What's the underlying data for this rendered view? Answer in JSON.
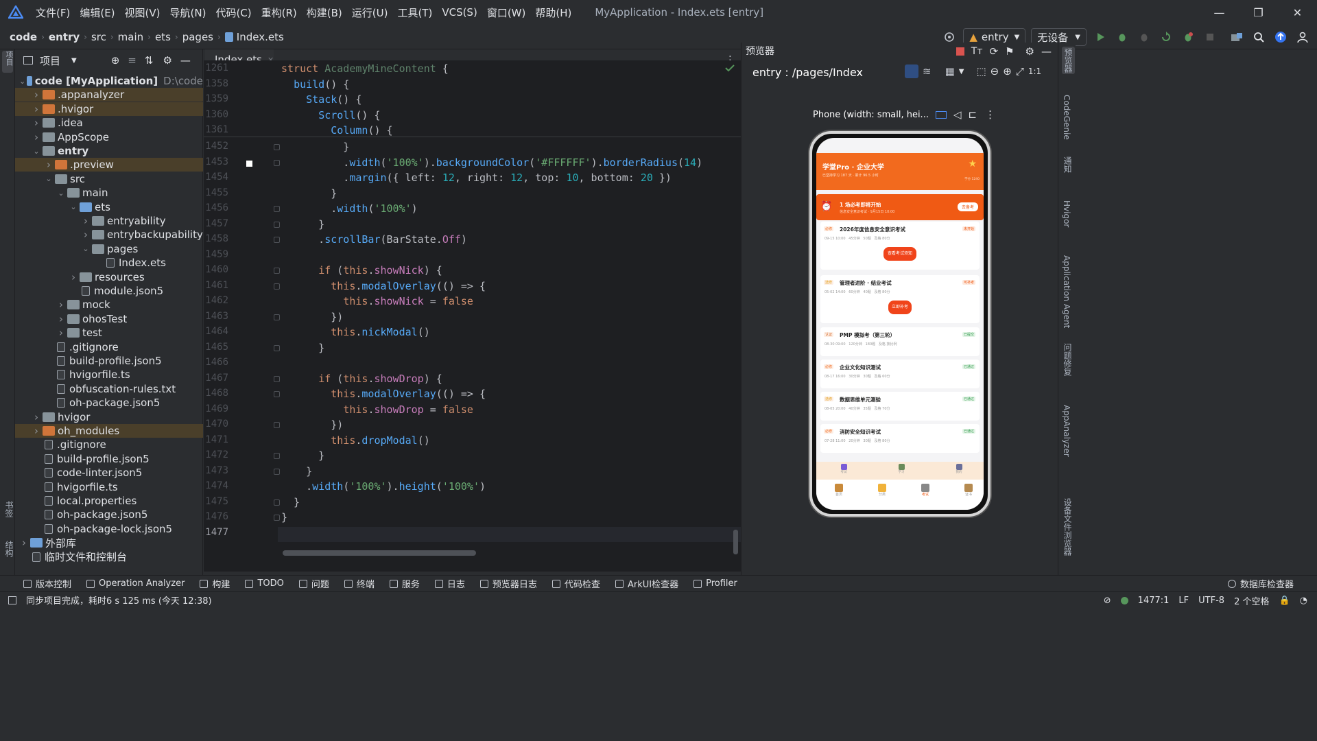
{
  "menu": [
    "文件(F)",
    "编辑(E)",
    "视图(V)",
    "导航(N)",
    "代码(C)",
    "重构(R)",
    "构建(B)",
    "运行(U)",
    "工具(T)",
    "VCS(S)",
    "窗口(W)",
    "帮助(H)"
  ],
  "window_title": "MyApplication - Index.ets [entry]",
  "breadcrumb": [
    "code",
    "entry",
    "src",
    "main",
    "ets",
    "pages",
    "Index.ets"
  ],
  "run_config": "entry",
  "device": "无设备",
  "project_panel": {
    "title": "项目",
    "tree": [
      {
        "depth": 0,
        "arrow": "open",
        "icon": "folder-blue",
        "label": "code [MyApplication]",
        "extra": "D:\\code",
        "bold": true
      },
      {
        "depth": 1,
        "arrow": "closed",
        "icon": "folder-orange",
        "label": ".appanalyzer",
        "hl": "sel"
      },
      {
        "depth": 1,
        "arrow": "closed",
        "icon": "folder-orange",
        "label": ".hvigor",
        "hl": "sel"
      },
      {
        "depth": 1,
        "arrow": "closed",
        "icon": "folder",
        "label": ".idea"
      },
      {
        "depth": 1,
        "arrow": "closed",
        "icon": "folder",
        "label": "AppScope"
      },
      {
        "depth": 1,
        "arrow": "open",
        "icon": "folder",
        "label": "entry",
        "bold": true
      },
      {
        "depth": 2,
        "arrow": "closed",
        "icon": "folder-orange",
        "label": ".preview",
        "hl": "sel"
      },
      {
        "depth": 2,
        "arrow": "open",
        "icon": "folder",
        "label": "src"
      },
      {
        "depth": 3,
        "arrow": "open",
        "icon": "folder",
        "label": "main"
      },
      {
        "depth": 4,
        "arrow": "open",
        "icon": "folder-blue",
        "label": "ets"
      },
      {
        "depth": 5,
        "arrow": "closed",
        "icon": "folder",
        "label": "entryability"
      },
      {
        "depth": 5,
        "arrow": "closed",
        "icon": "folder",
        "label": "entrybackupability"
      },
      {
        "depth": 5,
        "arrow": "open",
        "icon": "folder",
        "label": "pages"
      },
      {
        "depth": 6,
        "arrow": "none",
        "icon": "file",
        "label": "Index.ets"
      },
      {
        "depth": 4,
        "arrow": "closed",
        "icon": "folder",
        "label": "resources"
      },
      {
        "depth": 4,
        "arrow": "none",
        "icon": "file",
        "label": "module.json5"
      },
      {
        "depth": 3,
        "arrow": "closed",
        "icon": "folder",
        "label": "mock"
      },
      {
        "depth": 3,
        "arrow": "closed",
        "icon": "folder",
        "label": "ohosTest"
      },
      {
        "depth": 3,
        "arrow": "closed",
        "icon": "folder",
        "label": "test"
      },
      {
        "depth": 2,
        "arrow": "none",
        "icon": "file",
        "label": ".gitignore"
      },
      {
        "depth": 2,
        "arrow": "none",
        "icon": "file",
        "label": "build-profile.json5"
      },
      {
        "depth": 2,
        "arrow": "none",
        "icon": "file",
        "label": "hvigorfile.ts"
      },
      {
        "depth": 2,
        "arrow": "none",
        "icon": "file",
        "label": "obfuscation-rules.txt"
      },
      {
        "depth": 2,
        "arrow": "none",
        "icon": "file",
        "label": "oh-package.json5"
      },
      {
        "depth": 1,
        "arrow": "closed",
        "icon": "folder",
        "label": "hvigor"
      },
      {
        "depth": 1,
        "arrow": "closed",
        "icon": "folder-orange",
        "label": "oh_modules",
        "hl": "sel"
      },
      {
        "depth": 1,
        "arrow": "none",
        "icon": "file",
        "label": ".gitignore"
      },
      {
        "depth": 1,
        "arrow": "none",
        "icon": "file",
        "label": "build-profile.json5"
      },
      {
        "depth": 1,
        "arrow": "none",
        "icon": "file",
        "label": "code-linter.json5"
      },
      {
        "depth": 1,
        "arrow": "none",
        "icon": "file",
        "label": "hvigorfile.ts"
      },
      {
        "depth": 1,
        "arrow": "none",
        "icon": "file",
        "label": "local.properties"
      },
      {
        "depth": 1,
        "arrow": "none",
        "icon": "file",
        "label": "oh-package.json5"
      },
      {
        "depth": 1,
        "arrow": "none",
        "icon": "file",
        "label": "oh-package-lock.json5"
      },
      {
        "depth": 0,
        "arrow": "closed",
        "icon": "lib",
        "label": "外部库"
      },
      {
        "depth": 0,
        "arrow": "none",
        "icon": "scratch",
        "label": "临时文件和控制台"
      }
    ]
  },
  "left_stripe": {
    "top": "项目",
    "bottom1": "书签",
    "bottom2": "结构"
  },
  "editor": {
    "tab": "Index.ets",
    "sticky_lines": [
      {
        "n": "1261",
        "html": "<span class='kw'>struct</span> <span style='color:#5f826b'>AcademyMineContent</span> {"
      },
      {
        "n": "1358",
        "html": "  <span class='fn2'>build</span>() {"
      },
      {
        "n": "1359",
        "html": "    <span class='fn2'>Stack</span>() {"
      },
      {
        "n": "1360",
        "html": "      <span class='fn2'>Scroll</span>() {"
      },
      {
        "n": "1361",
        "html": "        <span class='fn2'>Column</span>() {"
      }
    ],
    "lines": [
      {
        "n": "1452",
        "html": "          }"
      },
      {
        "n": "1453",
        "html": "          .<span class='fn'>width</span>(<span class='str'>'100%'</span>).<span class='fn'>backgroundColor</span>(<span class='str'>'#FFFFFF'</span>).<span class='fn'>borderRadius</span>(<span class='num'>14</span>)"
      },
      {
        "n": "1454",
        "html": "          .<span class='fn'>margin</span>({ left: <span class='num'>12</span>, right: <span class='num'>12</span>, top: <span class='num'>10</span>, bottom: <span class='num'>20</span> })"
      },
      {
        "n": "1455",
        "html": "        }"
      },
      {
        "n": "1456",
        "html": "        .<span class='fn'>width</span>(<span class='str'>'100%'</span>)"
      },
      {
        "n": "1457",
        "html": "      }"
      },
      {
        "n": "1458",
        "html": "      .<span class='fn'>scrollBar</span>(BarState.<span class='prop'>Off</span>)"
      },
      {
        "n": "1459",
        "html": ""
      },
      {
        "n": "1460",
        "html": "      <span class='kw'>if</span> (<span class='kw'>this</span>.<span class='prop'>showNick</span>) {"
      },
      {
        "n": "1461",
        "html": "        <span class='kw'>this</span>.<span class='fn'>modalOverlay</span>(() => {"
      },
      {
        "n": "1462",
        "html": "          <span class='kw'>this</span>.<span class='prop'>showNick</span> = <span class='kw'>false</span>"
      },
      {
        "n": "1463",
        "html": "        })"
      },
      {
        "n": "1464",
        "html": "        <span class='kw'>this</span>.<span class='fn'>nickModal</span>()"
      },
      {
        "n": "1465",
        "html": "      }"
      },
      {
        "n": "1466",
        "html": ""
      },
      {
        "n": "1467",
        "html": "      <span class='kw'>if</span> (<span class='kw'>this</span>.<span class='prop'>showDrop</span>) {"
      },
      {
        "n": "1468",
        "html": "        <span class='kw'>this</span>.<span class='fn'>modalOverlay</span>(() => {"
      },
      {
        "n": "1469",
        "html": "          <span class='kw'>this</span>.<span class='prop'>showDrop</span> = <span class='kw'>false</span>"
      },
      {
        "n": "1470",
        "html": "        })"
      },
      {
        "n": "1471",
        "html": "        <span class='kw'>this</span>.<span class='fn'>dropModal</span>()"
      },
      {
        "n": "1472",
        "html": "      }"
      },
      {
        "n": "1473",
        "html": "    }"
      },
      {
        "n": "1474",
        "html": "    .<span class='fn'>width</span>(<span class='str'>'100%'</span>).<span class='fn'>height</span>(<span class='str'>'100%'</span>)"
      },
      {
        "n": "1475",
        "html": "  }"
      },
      {
        "n": "1476",
        "html": "}"
      },
      {
        "n": "1477",
        "html": ""
      }
    ]
  },
  "previewer": {
    "title": "预览器",
    "route": "entry : /pages/Index",
    "device_label": "Phone (width: small, hei...",
    "app": {
      "title": "学堂Pro · 企业大学",
      "subtitle": "已坚持学习 187 天 · 累计 96.5 小时",
      "badge": "学分 1240",
      "alert_title": "1 场必考即将开始",
      "alert_sub": "信息安全意识考试 · 9月15日 10:00",
      "alert_btn": "去备考",
      "cards": [
        {
          "tag": "必修",
          "title": "2026年度信息安全意识考试",
          "status": "未开始",
          "meta": "09-15 10:00   45分钟   50题   及格 80分",
          "button": "查看考试须知"
        },
        {
          "tag": "选修",
          "title": "管理者进阶 · 结业考试",
          "status": "可补考",
          "meta": "05-02 14:00   60分钟   40题   及格 80分",
          "button": "立即补考"
        },
        {
          "tag": "认证",
          "title": "PMP 模拟考（第三轮）",
          "status": "已提交",
          "meta": "08-30 09:00   120分钟   180题   及格 按比例",
          "button": ""
        },
        {
          "tag": "必修",
          "title": "企业文化知识测试",
          "status": "已通过",
          "meta": "08-17 16:00   30分钟   30题   及格 60分",
          "button": ""
        },
        {
          "tag": "选修",
          "title": "数据思维单元测验",
          "status": "已通过",
          "meta": "08-05 20:00   40分钟   35题   及格 70分",
          "button": ""
        },
        {
          "tag": "必修",
          "title": "消防安全知识考试",
          "status": "已通过",
          "meta": "07-28 11:00   20分钟   30题   及格 80分",
          "button": ""
        }
      ],
      "mid_tabs": [
        "考试",
        "学习",
        "我的"
      ],
      "nav": [
        "首页",
        "分类",
        "考试",
        "证书"
      ]
    }
  },
  "right_stripe": [
    "预览器",
    "CodeGenie",
    "通知",
    "Hvigor",
    "Application Agent",
    "问题修复",
    "AppAnalyzer",
    "设备文件浏览器"
  ],
  "tool_windows": [
    "版本控制",
    "Operation Analyzer",
    "构建",
    "TODO",
    "问题",
    "终端",
    "服务",
    "日志",
    "预览器日志",
    "代码检查",
    "ArkUI检查器",
    "Profiler"
  ],
  "db_inspector": "数据库检查器",
  "status": {
    "message": "同步项目完成，耗时6 s 125 ms (今天 12:38)",
    "position": "1477:1",
    "line_sep": "LF",
    "encoding": "UTF-8",
    "indent": "2 个空格"
  }
}
